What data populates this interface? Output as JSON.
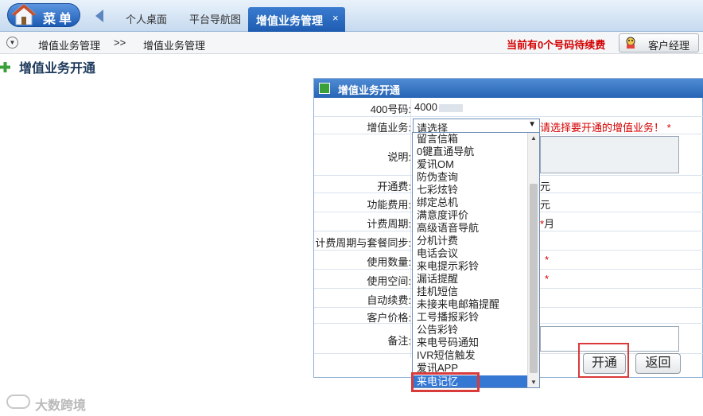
{
  "header": {
    "menu_label": "菜单",
    "tabs": [
      {
        "label": "个人桌面"
      },
      {
        "label": "平台导航图"
      }
    ],
    "active_tab": {
      "label": "增值业务管理",
      "close": "×"
    }
  },
  "breadcrumb": {
    "item1": "增值业务管理",
    "separator": ">>",
    "item2": "增值业务管理"
  },
  "notice": "当前有0个号码待续费",
  "account_manager_button": "客户经理",
  "page_title": "增值业务开通",
  "form": {
    "title": "增值业务开通",
    "fields": {
      "number_label": "400号码:",
      "number_value": "4000",
      "service_label": "增值业务:",
      "service_select": "请选择",
      "service_hint": "请选择要开通的增值业务！",
      "required_mark": "*",
      "description_label": "说明:",
      "opening_fee_label": "开通费:",
      "function_fee_label": "功能费用:",
      "billing_cycle_label": "计费周期:",
      "sync_label": "计费周期与套餐同步:",
      "usage_count_label": "使用数量:",
      "usage_space_label": "使用空间:",
      "auto_renew_label": "自动续费:",
      "customer_price_label": "客户价格:",
      "remarks_label": "备注:",
      "unit_yuan": "元",
      "unit_month": "月"
    }
  },
  "dropdown": {
    "options": [
      "留言信箱",
      "0键直通导航",
      "爱讯OM",
      "防伪查询",
      "七彩炫铃",
      "绑定总机",
      "满意度评价",
      "高级语音导航",
      "分机计费",
      "电话会议",
      "来电提示彩铃",
      "漏话提醒",
      "挂机短信",
      "未接来电邮箱提醒",
      "工号播报彩铃",
      "公告彩铃",
      "来电号码通知",
      "IVR短信触发",
      "爱讯APP"
    ],
    "selected": "来电记忆"
  },
  "buttons": {
    "open": "开通",
    "back": "返回"
  },
  "watermark": "大数跨境",
  "colors": {
    "accent": "#2765b5",
    "alert": "#d40000",
    "highlight_box": "#d93a3a",
    "selected_option": "#3478d4"
  }
}
